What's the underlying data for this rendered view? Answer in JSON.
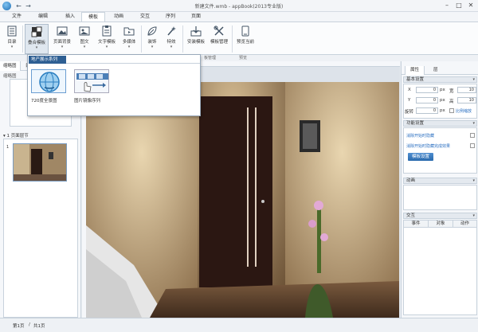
{
  "window": {
    "title": "新建文件.wmb - appBook(2013专业版)"
  },
  "menu": {
    "tabs": [
      "文件",
      "编辑",
      "插入",
      "模板",
      "动画",
      "交互",
      "序列",
      "页面"
    ],
    "active": 3
  },
  "ribbon": {
    "buttons": [
      {
        "label": "目录",
        "icon": "toc-icon"
      },
      {
        "label": "叠合模板",
        "icon": "overlay-template-icon"
      },
      {
        "label": "页面背景",
        "icon": "page-background-icon"
      },
      {
        "label": "图文",
        "icon": "image-text-icon"
      },
      {
        "label": "文字模板",
        "icon": "text-template-icon"
      },
      {
        "label": "多媒体",
        "icon": "multimedia-icon"
      },
      {
        "label": "装饰",
        "icon": "decoration-icon"
      },
      {
        "label": "特效",
        "icon": "effects-icon"
      },
      {
        "label": "安装模板",
        "icon": "install-template-icon"
      },
      {
        "label": "模板管理",
        "icon": "template-manage-icon"
      },
      {
        "label": "预览当前",
        "icon": "preview-icon"
      }
    ],
    "groups": [
      "板管理",
      "预览"
    ]
  },
  "dropdown": {
    "header": "地产展示系列",
    "items": [
      {
        "caption": "720度全景图"
      },
      {
        "caption": "图片镜像序列"
      }
    ]
  },
  "left_panel": {
    "tabs": [
      "缩略图",
      "目录"
    ],
    "sub_label": "缩略图",
    "section": "▾ 1 页面层节",
    "thumb_num": "1"
  },
  "right_panel": {
    "tabs": [
      "属性",
      "层"
    ],
    "basic_section": "基本设置",
    "fields": {
      "x_label": "X",
      "x_value": "0",
      "x_unit": "px",
      "w_label": "宽",
      "w_value": "10",
      "y_label": "Y",
      "y_value": "0",
      "y_unit": "px",
      "h_label": "高",
      "h_value": "10",
      "rot_label": "旋转",
      "rot_value": "0",
      "rot_unit": "px",
      "ratio_label": "比例缩放"
    },
    "function_section": "功能设置",
    "function_options": [
      "消除开始时隐藏",
      "消除开始时隐藏完成效果"
    ],
    "function_button": "模板设置",
    "animation_section": "动画",
    "interaction_section": "交互",
    "table_headers": [
      "事件",
      "对象",
      "动作"
    ]
  },
  "status": {
    "page": "第1页",
    "total": "共1页"
  },
  "colors": {
    "accent": "#2e5f93",
    "link": "#2a6fc1"
  }
}
